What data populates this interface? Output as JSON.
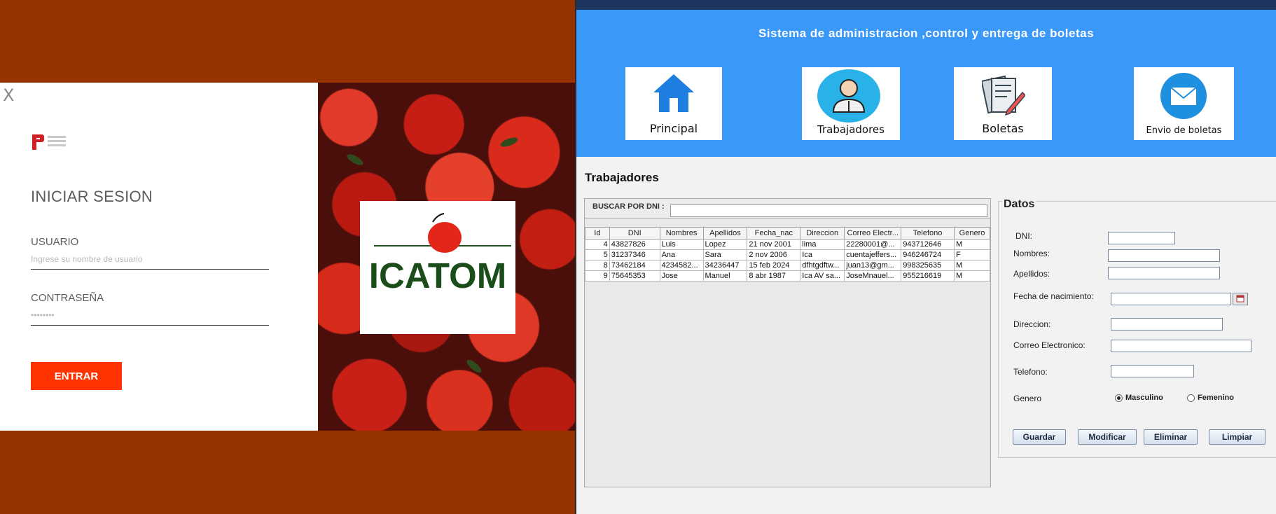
{
  "login": {
    "close": "X",
    "title": "INICIAR SESION",
    "user_label": "USUARIO",
    "user_placeholder": "Ingrese su nombre de usuario",
    "pass_label": "CONTRASEÑA",
    "pass_value": "••••••••",
    "submit": "ENTRAR",
    "brand": "ICATOM"
  },
  "app": {
    "title": "Sistema de administracion ,control y entrega de boletas",
    "nav": [
      {
        "label": "Principal",
        "icon": "home-icon"
      },
      {
        "label": "Trabajadores",
        "icon": "worker-icon"
      },
      {
        "label": "Boletas",
        "icon": "documents-icon"
      },
      {
        "label": "Envio de boletas",
        "icon": "mail-icon"
      }
    ],
    "section_title": "Trabajadores",
    "search_label": "BUSCAR POR DNI :",
    "table": {
      "columns": [
        "Id",
        "DNI",
        "Nombres",
        "Apellidos",
        "Fecha_nac",
        "Direccion",
        "Correo Electr...",
        "Telefono",
        "Genero"
      ],
      "rows": [
        [
          "4",
          "43827826",
          "Luis",
          "Lopez",
          "21 nov 2001",
          "lima",
          "22280001@...",
          "943712646",
          "M"
        ],
        [
          "5",
          "31237346",
          "Ana",
          "Sara",
          "2 nov 2006",
          "Ica",
          "cuentajeffers...",
          "946246724",
          "F"
        ],
        [
          "8",
          "73462184",
          "4234582...",
          "34236447",
          "15 feb 2024",
          "dfhtgdftw...",
          "juan13@gm...",
          "998325635",
          "M"
        ],
        [
          "9",
          "75645353",
          "Jose",
          "Manuel",
          "8 abr 1987",
          "Ica AV sa...",
          "JoseMnauel...",
          "955216619",
          "M"
        ]
      ]
    },
    "datos": {
      "legend": "Datos",
      "dni": "DNI:",
      "nombres": "Nombres:",
      "apellidos": "Apellidos:",
      "fecha": "Fecha de nacimiento:",
      "direccion": "Direccion:",
      "correo": "Correo Electronico:",
      "telefono": "Telefono:",
      "genero": "Genero",
      "masculino": "Masculino",
      "femenino": "Femenino"
    },
    "buttons": {
      "guardar": "Guardar",
      "modificar": "Modificar",
      "eliminar": "Eliminar",
      "limpiar": "Limpiar"
    }
  },
  "colors": {
    "background": "#993300",
    "accent_red": "#ff3300",
    "header_blue": "#3a99f8",
    "brand_green": "#1a4d1a"
  }
}
